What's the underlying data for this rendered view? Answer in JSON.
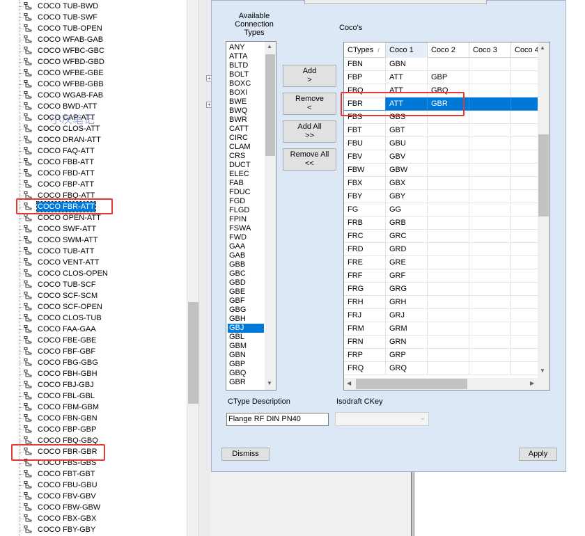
{
  "tree": {
    "rows": [
      {
        "label": "COCO TUB-BWD"
      },
      {
        "label": "COCO TUB-SWF"
      },
      {
        "label": "COCO TUB-OPEN"
      },
      {
        "label": "COCO WFAB-GAB"
      },
      {
        "label": "COCO WFBC-GBC"
      },
      {
        "label": "COCO WFBD-GBD"
      },
      {
        "label": "COCO WFBE-GBE"
      },
      {
        "label": "COCO WFBB-GBB"
      },
      {
        "label": "COCO WGAB-FAB"
      },
      {
        "label": "COCO BWD-ATT"
      },
      {
        "label": "COCO CAP-ATT"
      },
      {
        "label": "COCO CLOS-ATT"
      },
      {
        "label": "COCO DRAN-ATT"
      },
      {
        "label": "COCO FAQ-ATT"
      },
      {
        "label": "COCO FBB-ATT"
      },
      {
        "label": "COCO FBD-ATT"
      },
      {
        "label": "COCO FBP-ATT"
      },
      {
        "label": "COCO FBQ-ATT"
      },
      {
        "label": "COCO FBR-ATT",
        "selected": true
      },
      {
        "label": "COCO OPEN-ATT"
      },
      {
        "label": "COCO SWF-ATT"
      },
      {
        "label": "COCO SWM-ATT"
      },
      {
        "label": "COCO TUB-ATT"
      },
      {
        "label": "COCO VENT-ATT"
      },
      {
        "label": "COCO CLOS-OPEN"
      },
      {
        "label": "COCO TUB-SCF"
      },
      {
        "label": "COCO SCF-SCM"
      },
      {
        "label": "COCO SCF-OPEN"
      },
      {
        "label": "COCO CLOS-TUB"
      },
      {
        "label": "COCO FAA-GAA"
      },
      {
        "label": "COCO FBE-GBE"
      },
      {
        "label": "COCO FBF-GBF"
      },
      {
        "label": "COCO FBG-GBG"
      },
      {
        "label": "COCO FBH-GBH"
      },
      {
        "label": "COCO FBJ-GBJ"
      },
      {
        "label": "COCO FBL-GBL"
      },
      {
        "label": "COCO FBM-GBM"
      },
      {
        "label": "COCO FBN-GBN"
      },
      {
        "label": "COCO FBP-GBP"
      },
      {
        "label": "COCO FBQ-GBQ"
      },
      {
        "label": "COCO FBR-GBR"
      },
      {
        "label": "COCO FBS-GBS"
      },
      {
        "label": "COCO FBT-GBT"
      },
      {
        "label": "COCO FBU-GBU"
      },
      {
        "label": "COCO FBV-GBV"
      },
      {
        "label": "COCO FBW-GBW"
      },
      {
        "label": "COCO FBX-GBX"
      },
      {
        "label": "COCO FBY-GBY"
      }
    ],
    "watermark": "小灰笔记"
  },
  "dialog": {
    "available_title": "Available Connection Types",
    "cocos_title": "Coco's",
    "available_types": [
      "ANY",
      "ATTA",
      "BLTD",
      "BOLT",
      "BOXC",
      "BOXI",
      "BWE",
      "BWQ",
      "BWR",
      "CATT",
      "CIRC",
      "CLAM",
      "CRS",
      "DUCT",
      "ELEC",
      "FAB",
      "FDUC",
      "FGD",
      "FLGD",
      "FPIN",
      "FSWA",
      "FWD",
      "GAA",
      "GAB",
      "GBB",
      "GBC",
      "GBD",
      "GBE",
      "GBF",
      "GBG",
      "GBH",
      "GBJ",
      "GBL",
      "GBM",
      "GBN",
      "GBP",
      "GBQ",
      "GBR"
    ],
    "available_selected": "GBJ",
    "buttons": {
      "add": [
        "Add",
        ">"
      ],
      "remove": [
        "Remove",
        "<"
      ],
      "add_all": [
        "Add All",
        ">>"
      ],
      "remove_all": [
        "Remove All",
        "<<"
      ],
      "dismiss": "Dismiss",
      "apply": "Apply"
    },
    "grid": {
      "columns": [
        "CTypes",
        "Coco 1",
        "Coco 2",
        "Coco 3",
        "Coco 4"
      ],
      "sort_indicator": "/",
      "rows": [
        [
          "FBN",
          "GBN",
          "",
          "",
          ""
        ],
        [
          "FBP",
          "ATT",
          "GBP",
          "",
          ""
        ],
        [
          "FBQ",
          "ATT",
          "GBQ",
          "",
          ""
        ],
        [
          "FBR",
          "ATT",
          "GBR",
          "",
          ""
        ],
        [
          "FBS",
          "GBS",
          "",
          "",
          ""
        ],
        [
          "FBT",
          "GBT",
          "",
          "",
          ""
        ],
        [
          "FBU",
          "GBU",
          "",
          "",
          ""
        ],
        [
          "FBV",
          "GBV",
          "",
          "",
          ""
        ],
        [
          "FBW",
          "GBW",
          "",
          "",
          ""
        ],
        [
          "FBX",
          "GBX",
          "",
          "",
          ""
        ],
        [
          "FBY",
          "GBY",
          "",
          "",
          ""
        ],
        [
          "FG",
          "GG",
          "",
          "",
          ""
        ],
        [
          "FRB",
          "GRB",
          "",
          "",
          ""
        ],
        [
          "FRC",
          "GRC",
          "",
          "",
          ""
        ],
        [
          "FRD",
          "GRD",
          "",
          "",
          ""
        ],
        [
          "FRE",
          "GRE",
          "",
          "",
          ""
        ],
        [
          "FRF",
          "GRF",
          "",
          "",
          ""
        ],
        [
          "FRG",
          "GRG",
          "",
          "",
          ""
        ],
        [
          "FRH",
          "GRH",
          "",
          "",
          ""
        ],
        [
          "FRJ",
          "GRJ",
          "",
          "",
          ""
        ],
        [
          "FRM",
          "GRM",
          "",
          "",
          ""
        ],
        [
          "FRN",
          "GRN",
          "",
          "",
          ""
        ],
        [
          "FRP",
          "GRP",
          "",
          "",
          ""
        ],
        [
          "FRQ",
          "GRQ",
          "",
          "",
          ""
        ]
      ],
      "selected_row": 3
    },
    "ctype_description_label": "CType Description",
    "ctype_description_value": "Flange RF DIN PN40",
    "isodraft_label": "Isodraft CKey",
    "isodraft_value": ""
  },
  "colors": {
    "selection": "#0078d7",
    "highlight_box": "#e53935",
    "dialog_bg": "#dde8f6"
  }
}
